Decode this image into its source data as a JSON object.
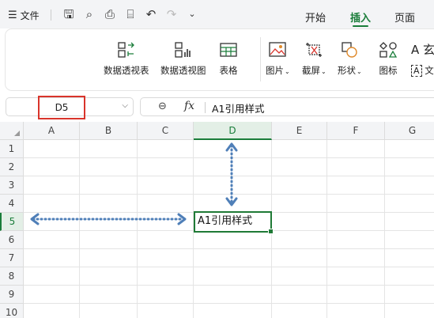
{
  "topbar": {
    "menu_label": "文件",
    "tabs": [
      "开始",
      "插入",
      "页面"
    ],
    "active_tab": "插入"
  },
  "ribbon": {
    "buttons": [
      {
        "label": "数据透视表",
        "icon": "pivot-table-icon"
      },
      {
        "label": "数据透视图",
        "icon": "pivot-chart-icon"
      },
      {
        "label": "表格",
        "icon": "table-icon"
      },
      {
        "label": "图片",
        "icon": "picture-icon",
        "dropdown": true
      },
      {
        "label": "截屏",
        "icon": "screenshot-icon",
        "dropdown": true
      },
      {
        "label": "形状",
        "icon": "shapes-icon",
        "dropdown": true
      },
      {
        "label": "图标",
        "icon": "icons-icon"
      },
      {
        "label": "文",
        "icon": "textbox-icon"
      }
    ],
    "partial_label": "玄"
  },
  "formula": {
    "name_box": "D5",
    "fx": "fx",
    "content": "A1引用样式"
  },
  "sheet": {
    "columns": [
      "A",
      "B",
      "C",
      "D",
      "E",
      "F",
      "G"
    ],
    "rows": [
      "1",
      "2",
      "3",
      "4",
      "5",
      "6",
      "7",
      "8",
      "9",
      "10"
    ],
    "selected_col": "D",
    "selected_row": "5",
    "active_cell_text": "A1引用样式"
  },
  "colors": {
    "accent": "#1a7d3a",
    "highlight": "#d9342b",
    "arrow": "#4f7fb8"
  }
}
